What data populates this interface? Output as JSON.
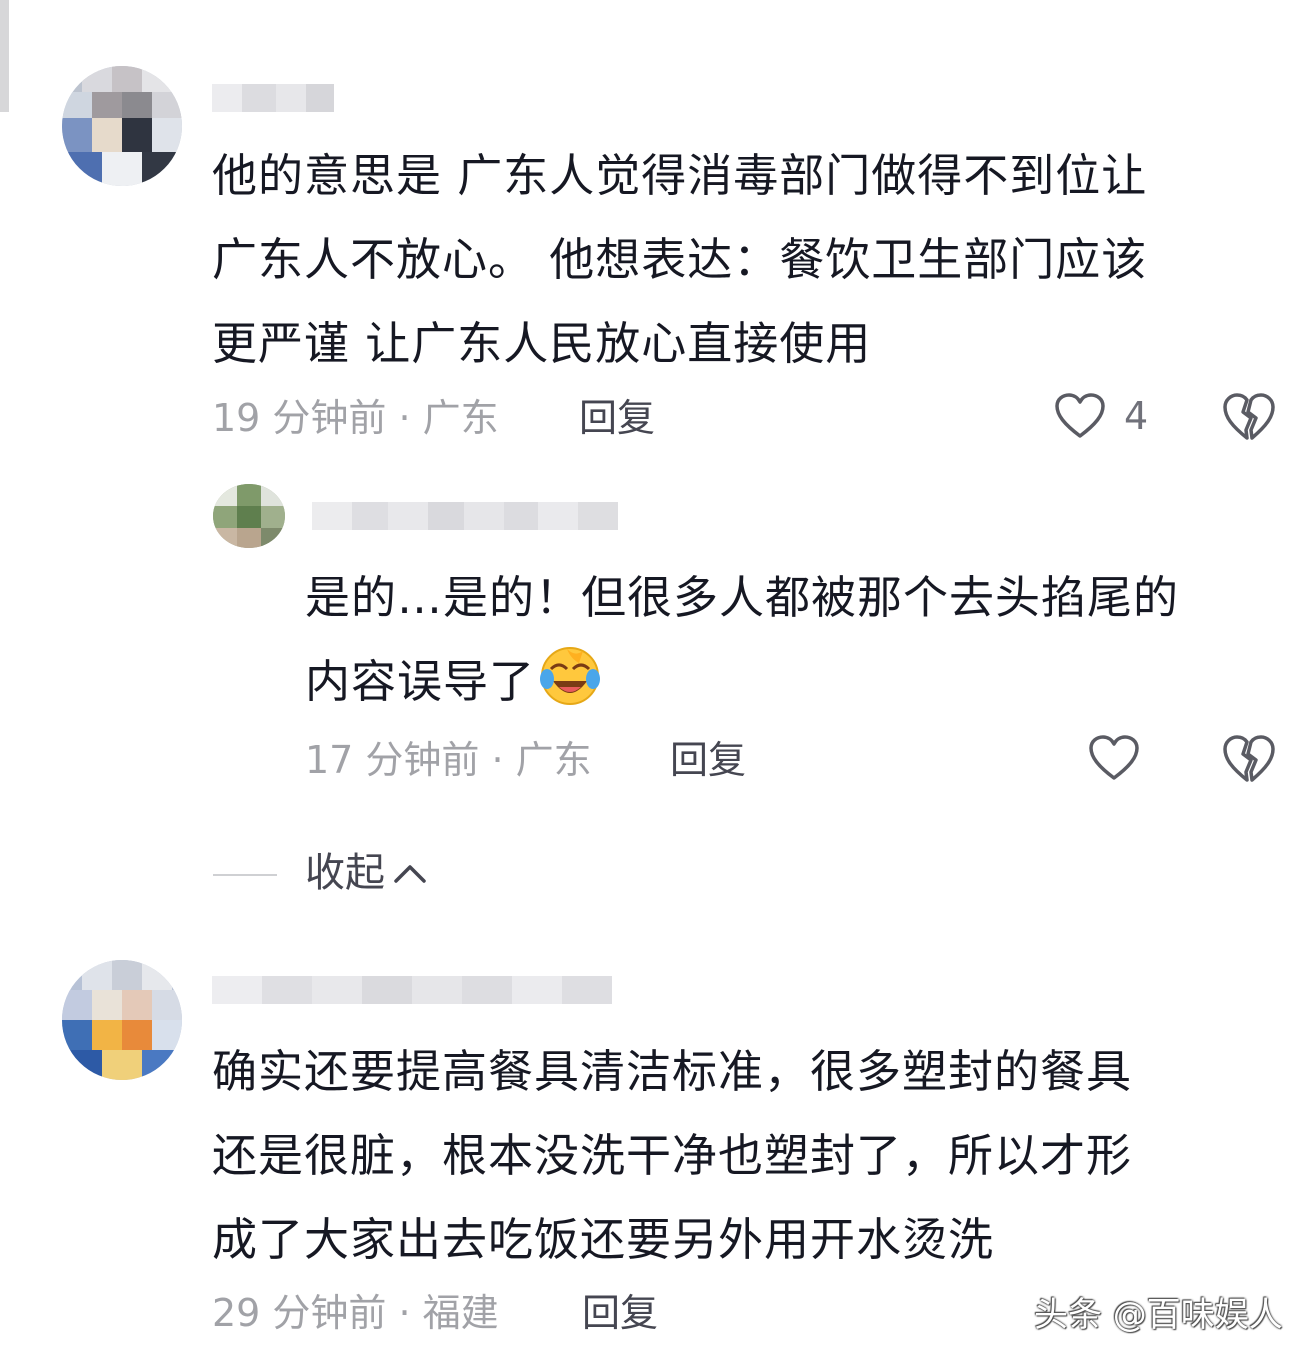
{
  "comments": [
    {
      "text": "他的意思是 广东人觉得消毒部门做得不到位让\n广东人不放心。 他想表达：餐饮卫生部门应该\n更严谨 让广东人民放心直接使用",
      "meta": "19 分钟前 · 广东",
      "reply_label": "回复",
      "like_count": "4"
    },
    {
      "text": "是的…是的！但很多人都被那个去头掐尾的\n内容误导了",
      "emoji": "laughing-crying-emoji",
      "meta": "17 分钟前 · 广东",
      "reply_label": "回复",
      "like_count": ""
    },
    {
      "text": "确实还要提高餐具清洁标准，很多塑封的餐具\n还是很脏，根本没洗干净也塑封了，所以才形\n成了大家出去吃饭还要另外用开水烫洗",
      "meta": "29 分钟前 · 福建",
      "reply_label": "回复"
    }
  ],
  "collapse_label": "收起",
  "watermark": "头条 @百味娱人",
  "icons": {
    "like": "heart-outline-icon",
    "dislike": "broken-heart-icon",
    "collapse": "chevron-up-icon"
  },
  "colors": {
    "text": "#161823",
    "meta": "#a1a2a7",
    "icon": "#5a5b63"
  }
}
